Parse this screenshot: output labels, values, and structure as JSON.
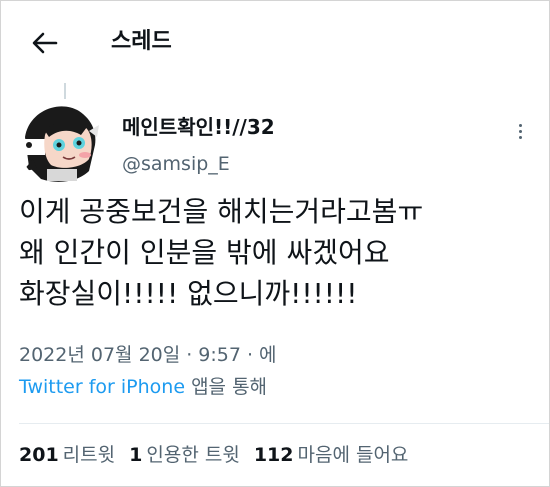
{
  "header": {
    "title": "스레드",
    "back_icon": "arrow-left-icon"
  },
  "tweet": {
    "display_name": "메인트확인!!//32",
    "handle": "@samsip_E",
    "more_icon": "more-vertical-icon",
    "text_lines": [
      "이게 공중보건을 해치는거라고봄ㅠ",
      "왜 인간이 인분을 밖에 싸겠어요",
      "화장실이!!!!! 없으니까!!!!!!"
    ],
    "date": "2022년 07월 20일",
    "separator": "·",
    "time": "9:57",
    "time_suffix": "에",
    "source_app": "Twitter for iPhone",
    "source_suffix": "앱을 통해"
  },
  "stats": {
    "retweets_count": "201",
    "retweets_label": "리트윗",
    "quotes_count": "1",
    "quotes_label": "인용한 트윗",
    "likes_count": "112",
    "likes_label": "마음에 들어요"
  },
  "colors": {
    "text": "#0f1419",
    "secondary": "#536471",
    "link": "#1d9bf0",
    "divider": "#e6ecf0"
  }
}
